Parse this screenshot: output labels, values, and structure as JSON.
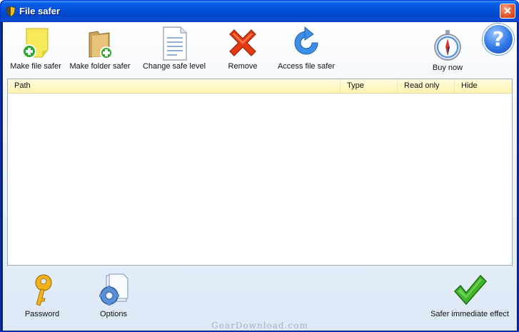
{
  "window": {
    "title": "File safer",
    "close_glyph": "✕"
  },
  "toolbar": {
    "make_file_safer": "Make file safer",
    "make_folder_safer": "Make folder safer",
    "change_safe_level": "Change safe level",
    "remove": "Remove",
    "access_file_safer": "Access file safer",
    "buy_now": "Buy now",
    "help_glyph": "?"
  },
  "list": {
    "columns": [
      "Path",
      "Type",
      "Read only",
      "Hide"
    ],
    "rows": []
  },
  "bottombar": {
    "password": "Password",
    "options": "Options",
    "safer_immediate_effect": "Safer immediate effect"
  },
  "watermark": "GearDownload.com",
  "icons": {
    "make_file_safer": "sticky-note-plus-icon",
    "make_folder_safer": "folder-plus-icon",
    "change_safe_level": "document-lines-icon",
    "remove": "red-x-icon",
    "access_file_safer": "refresh-arrow-icon",
    "buy_now": "compass-icon",
    "help": "help-icon",
    "password": "key-icon",
    "options": "gear-document-icon",
    "safer_immediate_effect": "checkmark-icon"
  },
  "colors": {
    "titlebar": "#0250d8",
    "list_header": "#fff3b0",
    "client_bg": "#dde9f6"
  }
}
